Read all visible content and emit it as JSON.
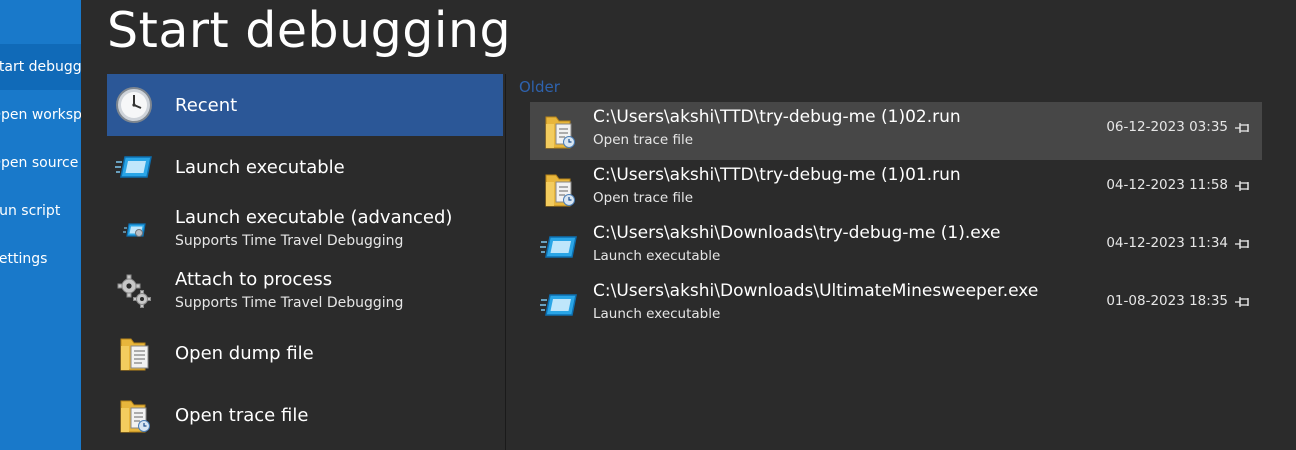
{
  "sidebar": {
    "items": [
      {
        "label": "Start debugging",
        "active": true
      },
      {
        "label": "Open workspace"
      },
      {
        "label": "Open source file"
      },
      {
        "label": "Run script"
      },
      {
        "label": "Settings"
      }
    ]
  },
  "page_title": "Start debugging",
  "menu": {
    "items": [
      {
        "label": "Recent",
        "icon": "clock-icon",
        "selected": true
      },
      {
        "label": "Launch executable",
        "icon": "executable-window-icon"
      },
      {
        "label": "Launch executable (advanced)",
        "sub": "Supports Time Travel Debugging",
        "icon": "executable-advanced-icon"
      },
      {
        "label": "Attach to process",
        "sub": "Supports Time Travel Debugging",
        "icon": "gears-icon"
      },
      {
        "label": "Open dump file",
        "icon": "dump-file-folder-icon"
      },
      {
        "label": "Open trace file",
        "icon": "trace-file-folder-icon"
      }
    ]
  },
  "recent": {
    "group_label": "Older",
    "items": [
      {
        "path": "C:\\Users\\akshi\\TTD\\try-debug-me (1)02.run",
        "type": "Open trace file",
        "date": "06-12-2023 03:35",
        "icon": "trace-file-folder-icon",
        "selected": true
      },
      {
        "path": "C:\\Users\\akshi\\TTD\\try-debug-me (1)01.run",
        "type": "Open trace file",
        "date": "04-12-2023 11:58",
        "icon": "trace-file-folder-icon"
      },
      {
        "path": "C:\\Users\\akshi\\Downloads\\try-debug-me (1).exe",
        "type": "Launch executable",
        "date": "04-12-2023 11:34",
        "icon": "executable-window-icon"
      },
      {
        "path": "C:\\Users\\akshi\\Downloads\\UltimateMinesweeper.exe",
        "type": "Launch executable",
        "date": "01-08-2023 18:35",
        "icon": "executable-window-icon"
      }
    ]
  },
  "colors": {
    "sidebar": "#1979ca",
    "sidebar_active": "#106ab8",
    "background": "#2b2b2b",
    "menu_selected": "#2b5797",
    "recent_selected": "#474747",
    "group_label": "#2e62ad"
  }
}
